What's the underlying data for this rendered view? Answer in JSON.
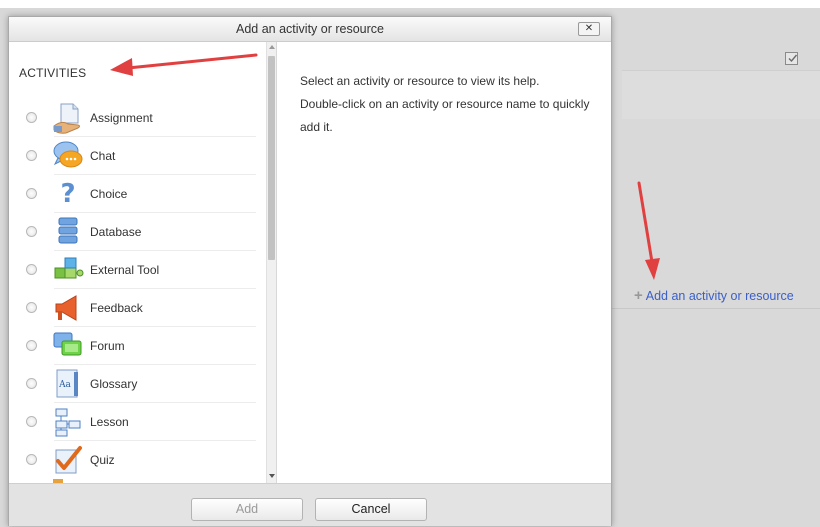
{
  "dialog": {
    "title": "Add an activity or resource",
    "section_header": "ACTIVITIES",
    "items": [
      {
        "label": "Assignment",
        "icon": "assignment-icon"
      },
      {
        "label": "Chat",
        "icon": "chat-icon"
      },
      {
        "label": "Choice",
        "icon": "choice-icon"
      },
      {
        "label": "Database",
        "icon": "database-icon"
      },
      {
        "label": "External Tool",
        "icon": "external-tool-icon"
      },
      {
        "label": "Feedback",
        "icon": "feedback-icon"
      },
      {
        "label": "Forum",
        "icon": "forum-icon"
      },
      {
        "label": "Glossary",
        "icon": "glossary-icon"
      },
      {
        "label": "Lesson",
        "icon": "lesson-icon"
      },
      {
        "label": "Quiz",
        "icon": "quiz-icon"
      }
    ],
    "help_line1": "Select an activity or resource to view its help.",
    "help_line2": "Double-click on an activity or resource name to quickly add it.",
    "add_button": "Add",
    "cancel_button": "Cancel",
    "close_glyph": "✕"
  },
  "page": {
    "add_link": "Add an activity or resource"
  },
  "colors": {
    "annotation_arrow": "#e04040",
    "link": "#3a5fc8"
  }
}
